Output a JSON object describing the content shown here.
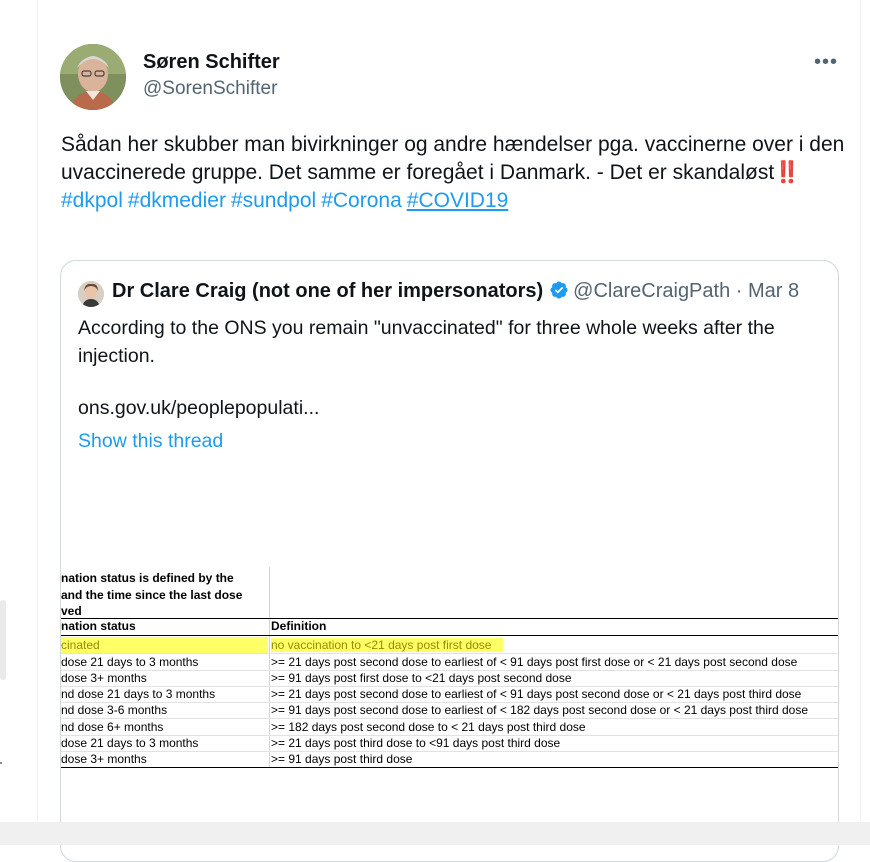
{
  "author": {
    "name": "Søren Schifter",
    "handle": "@SorenSchifter"
  },
  "tweet": {
    "text": "Sådan her skubber man bivirkninger og andre hændelser pga. vaccinerne over i den uvaccinerede gruppe. Det samme er foregået i Danmark. - Det er skandaløst",
    "emoji": "‼️",
    "hashtags": [
      "#dkpol",
      "#dkmedier",
      "#sundpol",
      "#Corona",
      "#COVID19"
    ]
  },
  "more_icon": "more-horizontal-icon",
  "quote": {
    "author_name": "Dr Clare Craig (not one of her impersonators)",
    "handle": "@ClareCraigPath",
    "separator": "·",
    "date": "Mar 8",
    "verified_icon": "verified-badge-icon",
    "text": "According to the ONS you remain \"unvaccinated\" for three whole weeks after the injection.",
    "link": "ons.gov.uk/peoplepopulati...",
    "show_thread": "Show this thread"
  },
  "document": {
    "header_lines": [
      "nation status is defined by the",
      "and the time since the last dose",
      "ved"
    ],
    "col1_header": "nation status",
    "col2_header": "Definition",
    "rows": [
      {
        "status": "cinated",
        "definition": "no vaccination to <21 days post first dose",
        "highlight": true
      },
      {
        "status": "dose 21 days to 3 months",
        "definition": ">= 21 days post second dose to earliest of < 91 days post first dose or < 21 days post second dose",
        "highlight": false
      },
      {
        "status": "dose 3+ months",
        "definition": ">= 91 days post first dose to <21 days post second dose",
        "highlight": false
      },
      {
        "status": "nd dose 21 days to 3 months",
        "definition": ">= 21 days post second dose to earliest of < 91 days post second dose or < 21 days post third dose",
        "highlight": false
      },
      {
        "status": "nd dose 3-6 months",
        "definition": ">= 91 days post second dose to earliest of < 182 days post second dose or < 21 days post third dose",
        "highlight": false
      },
      {
        "status": "nd dose 6+ months",
        "definition": ">= 182 days post second dose to < 21 days post third dose",
        "highlight": false
      },
      {
        "status": "dose 21 days to 3 months",
        "definition": ">= 21 days post third dose to <91 days post third dose",
        "highlight": false
      },
      {
        "status": "dose 3+ months",
        "definition": ">= 91 days post third dose",
        "highlight": false
      }
    ]
  }
}
